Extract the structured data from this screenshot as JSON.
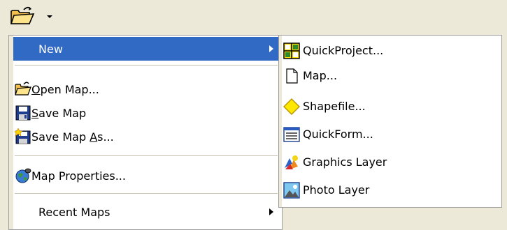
{
  "toolbar": {
    "open_icon": "open-folder-icon",
    "dropdown_icon": "dropdown-arrow-icon"
  },
  "menu": {
    "new": {
      "label": "New"
    },
    "open_map": {
      "label_prefix": "",
      "mnemonic": "O",
      "label_rest": "pen Map..."
    },
    "save_map": {
      "mnemonic": "S",
      "label_rest": "ave Map"
    },
    "save_map_as": {
      "label_prefix": "Save Map ",
      "mnemonic": "A",
      "label_rest": "s..."
    },
    "map_properties": {
      "label": "Map Properties..."
    },
    "recent_maps": {
      "label": "Recent Maps"
    }
  },
  "submenu": {
    "items": [
      {
        "label": "QuickProject...",
        "icon": "quickproject-icon"
      },
      {
        "label": "Map...",
        "icon": "blank-document-icon"
      },
      {
        "label": "Shapefile...",
        "icon": "yellow-diamond-icon"
      },
      {
        "label": "QuickForm...",
        "icon": "form-window-icon"
      },
      {
        "label": "Graphics Layer",
        "icon": "graphics-layer-icon"
      },
      {
        "label": "Photo Layer",
        "icon": "photo-layer-icon"
      }
    ]
  },
  "colors": {
    "highlight": "#316ac5",
    "menu_bg": "#ffffff",
    "chrome": "#ece9d8"
  }
}
